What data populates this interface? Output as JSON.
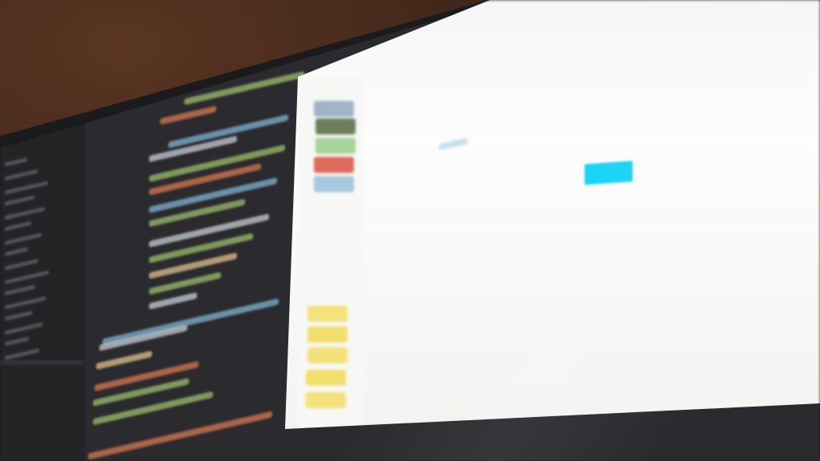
{
  "app": {
    "editor_theme": "dark",
    "preview_theme": "light"
  },
  "colors": {
    "room": "#3a2317",
    "bezel": "#1b1a1d",
    "editor_bg": "#2b2a2e",
    "gutter_bg": "#242326",
    "preview_bg": "#fdfdfd",
    "accent_cyan": "#12d2f5"
  },
  "preview": {
    "swatches": [
      {
        "name": "blue-grey",
        "color": "#9fb4c7"
      },
      {
        "name": "dark-olive",
        "color": "#6d7f5a"
      },
      {
        "name": "light-green",
        "color": "#a8d49a"
      },
      {
        "name": "red",
        "color": "#e06a5c"
      },
      {
        "name": "sky-blue",
        "color": "#a9c7dd"
      },
      {
        "name": "yellow-1",
        "color": "#f3e27a"
      },
      {
        "name": "yellow-2",
        "color": "#f1df6c"
      },
      {
        "name": "yellow-3",
        "color": "#f3e27a"
      },
      {
        "name": "yellow-4",
        "color": "#f1df6c"
      },
      {
        "name": "yellow-5",
        "color": "#f3e27a"
      }
    ],
    "primary_button": {
      "color": "#12d2f5",
      "label": ""
    }
  }
}
